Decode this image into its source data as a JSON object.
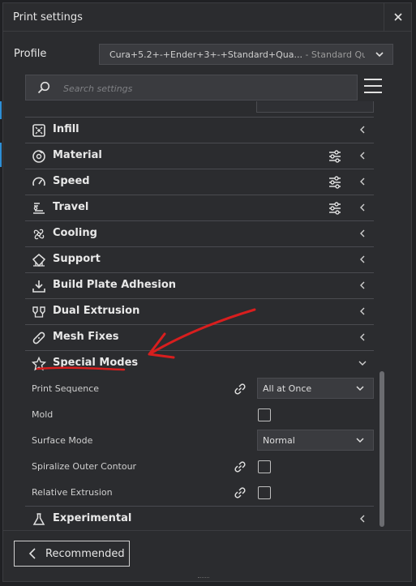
{
  "window": {
    "title": "Print settings"
  },
  "profile": {
    "label": "Profile",
    "value": "Cura+5.2+-+Ender+3+-+Standard+Qua...",
    "suffix": " - Standard Qu..."
  },
  "search": {
    "placeholder": "Search settings"
  },
  "categories": [
    {
      "label": "Infill",
      "icon": "infill-icon",
      "has_sliders": false
    },
    {
      "label": "Material",
      "icon": "material-icon",
      "has_sliders": true
    },
    {
      "label": "Speed",
      "icon": "speed-icon",
      "has_sliders": true
    },
    {
      "label": "Travel",
      "icon": "travel-icon",
      "has_sliders": true
    },
    {
      "label": "Cooling",
      "icon": "cooling-icon",
      "has_sliders": false
    },
    {
      "label": "Support",
      "icon": "support-icon",
      "has_sliders": false
    },
    {
      "label": "Build Plate Adhesion",
      "icon": "build-plate-icon",
      "has_sliders": false
    },
    {
      "label": "Dual Extrusion",
      "icon": "dual-extrusion-icon",
      "has_sliders": false
    },
    {
      "label": "Mesh Fixes",
      "icon": "mesh-fixes-icon",
      "has_sliders": false
    },
    {
      "label": "Special Modes",
      "icon": "star-icon",
      "expanded": true
    },
    {
      "label": "Experimental",
      "icon": "flask-icon",
      "has_sliders": false
    }
  ],
  "special_modes": {
    "print_sequence": {
      "label": "Print Sequence",
      "value": "All at Once"
    },
    "mold": {
      "label": "Mold",
      "checked": false
    },
    "surface_mode": {
      "label": "Surface Mode",
      "value": "Normal"
    },
    "spiralize": {
      "label": "Spiralize Outer Contour",
      "checked": false
    },
    "relative_extrusion": {
      "label": "Relative Extrusion",
      "checked": false
    }
  },
  "footer": {
    "recommended_label": "Recommended"
  },
  "colors": {
    "annotation": "#d81e1e",
    "panel": "#2b2c2f",
    "accent_edge": "#2e8fd6"
  }
}
